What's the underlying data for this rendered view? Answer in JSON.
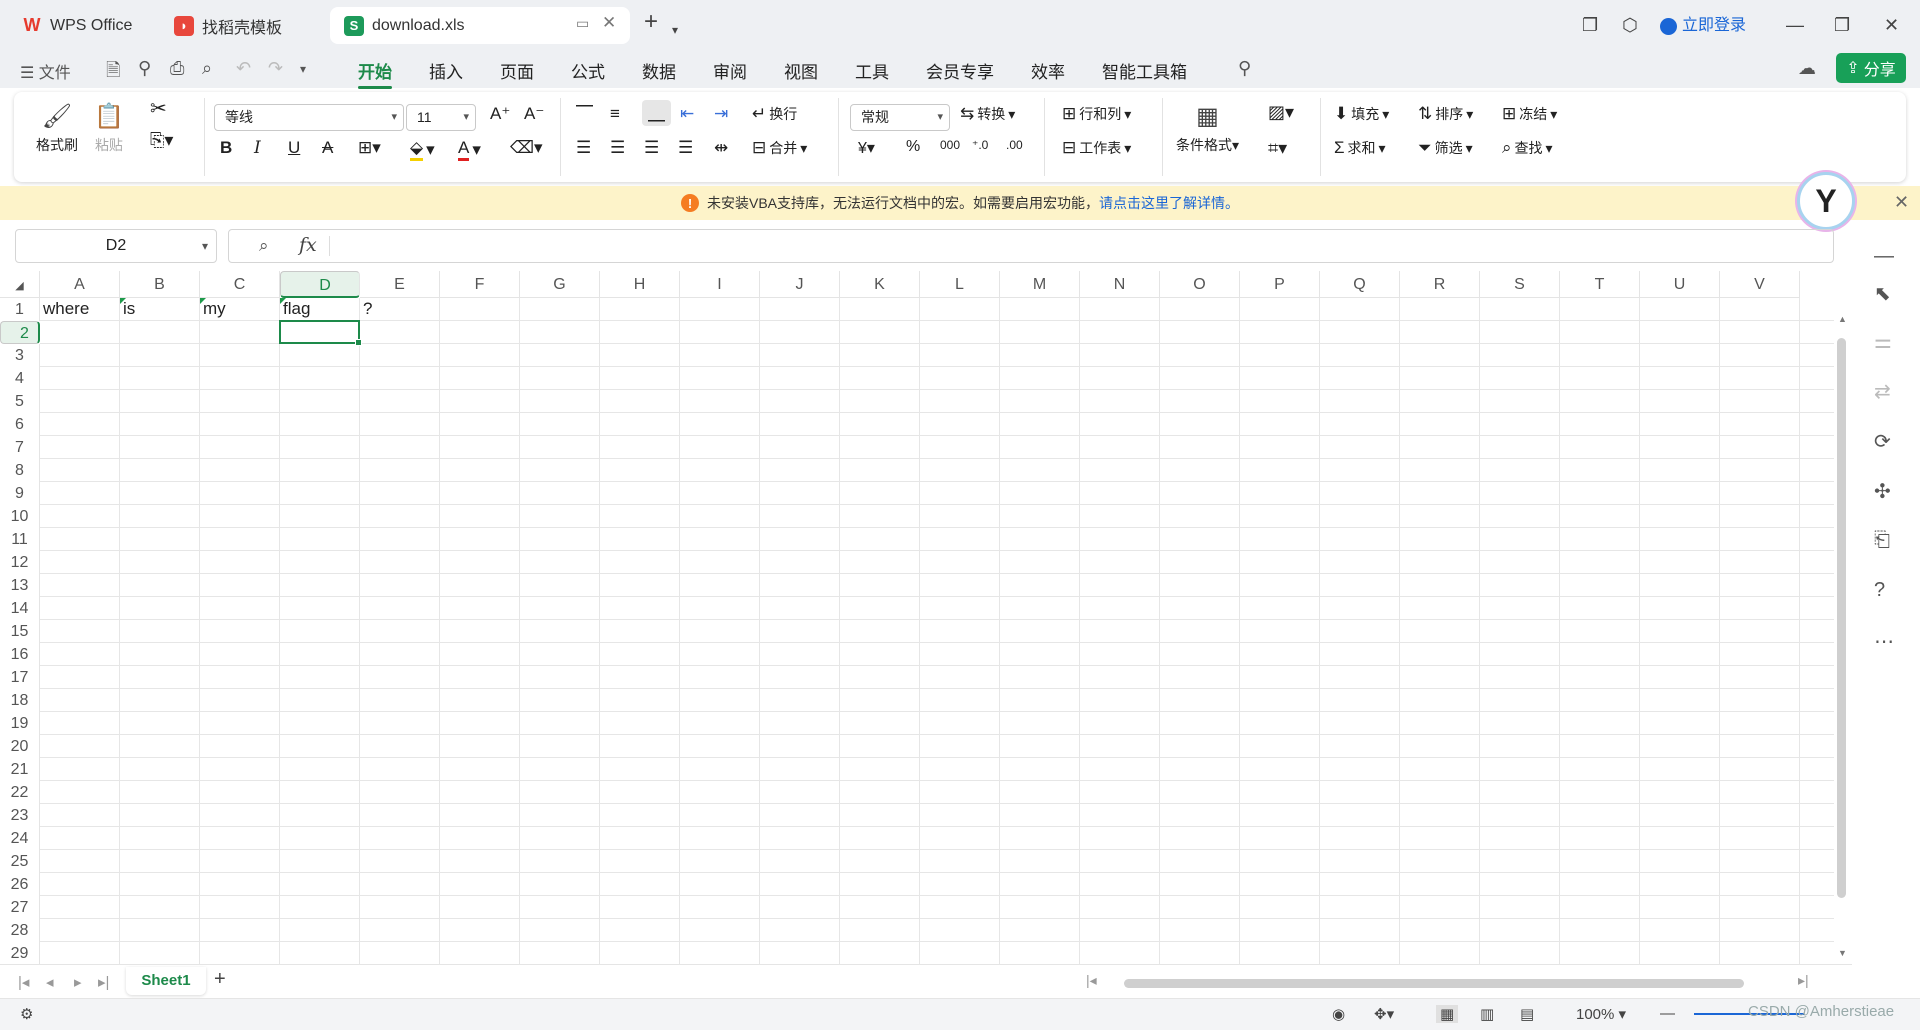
{
  "tabs": [
    {
      "label": "WPS Office",
      "icon": "wps-logo-icon"
    },
    {
      "label": "找稻壳模板",
      "icon": "docer-icon"
    },
    {
      "label": "download.xls",
      "icon": "sheet-icon"
    }
  ],
  "titlebar": {
    "login": "立即登录"
  },
  "menu": {
    "file": "文件",
    "items": [
      "开始",
      "插入",
      "页面",
      "公式",
      "数据",
      "审阅",
      "视图",
      "工具",
      "会员专享",
      "效率",
      "智能工具箱"
    ],
    "share": "分享"
  },
  "ribbon": {
    "format_painter": "格式刷",
    "paste": "粘贴",
    "font_name": "等线",
    "font_size": "11",
    "wrap": "换行",
    "merge": "合并",
    "number_format": "常规",
    "convert": "转换",
    "row_col": "行和列",
    "worksheet": "工作表",
    "cond_format": "条件格式",
    "fill": "填充",
    "sort": "排序",
    "freeze": "冻结",
    "sum": "求和",
    "filter": "筛选",
    "find": "查找"
  },
  "notice": {
    "text": "未安装VBA支持库，无法运行文档中的宏。如需要启用宏功能，",
    "link": "请点击这里了解详情。"
  },
  "formula": {
    "name_box": "D2",
    "value": ""
  },
  "columns": [
    "A",
    "B",
    "C",
    "D",
    "E",
    "F",
    "G",
    "H",
    "I",
    "J",
    "K",
    "L",
    "M",
    "N",
    "O",
    "P",
    "Q",
    "R",
    "S",
    "T",
    "U",
    "V"
  ],
  "rows": [
    "1",
    "2",
    "3",
    "4",
    "5",
    "6",
    "7",
    "8",
    "9",
    "10",
    "11",
    "12",
    "13",
    "14",
    "15",
    "16",
    "17",
    "18",
    "19",
    "20",
    "21",
    "22",
    "23",
    "24",
    "25",
    "26",
    "27",
    "28",
    "29"
  ],
  "selected": {
    "column": "D",
    "row": "2"
  },
  "cells": [
    {
      "ref": "A1",
      "value": "where"
    },
    {
      "ref": "B1",
      "value": "is"
    },
    {
      "ref": "C1",
      "value": "my"
    },
    {
      "ref": "D1",
      "value": "flag"
    },
    {
      "ref": "E1",
      "value": "?"
    }
  ],
  "sheets": [
    "Sheet1"
  ],
  "status": {
    "zoom": "100%"
  },
  "watermark": "CSDN @Amherstieae",
  "colors": {
    "accent": "#1d8a4a",
    "share": "#18a058",
    "notice_bg": "#fdf3c9"
  }
}
